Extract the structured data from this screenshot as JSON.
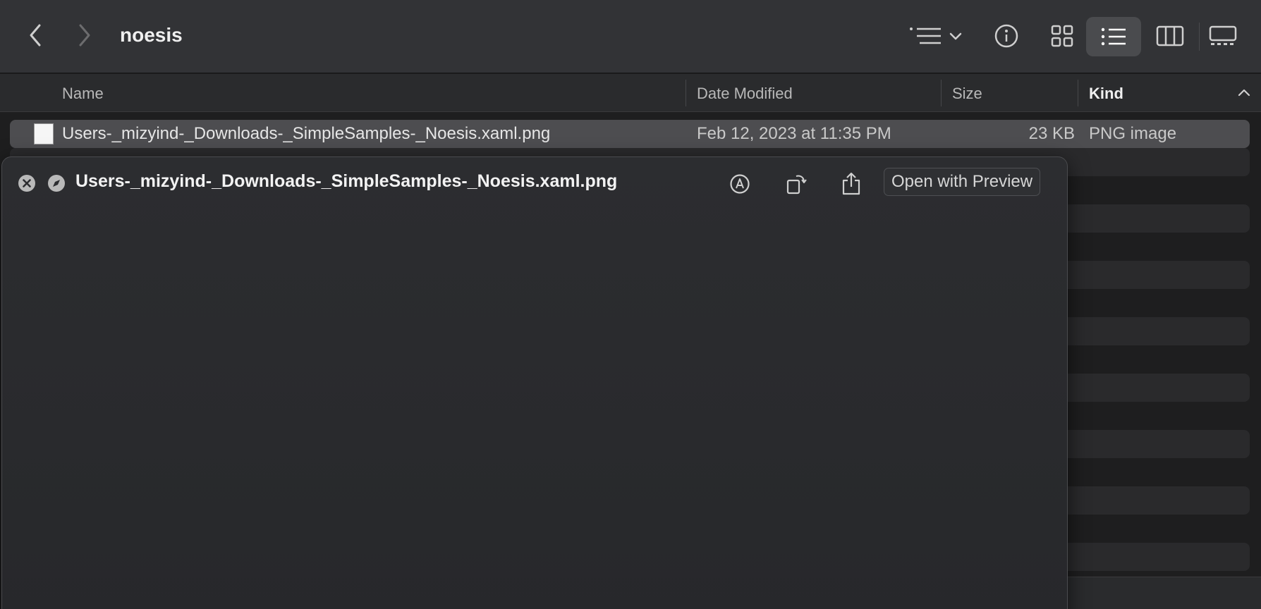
{
  "window": {
    "title": "noesis"
  },
  "toolbar": {
    "back_icon": "chevron-left-icon",
    "forward_icon": "chevron-right-icon",
    "sort_icon": "group-sort-icon",
    "info_icon": "info-icon",
    "view_icons": "icon-view-icon",
    "view_list": "list-view-icon",
    "view_columns": "column-view-icon",
    "view_gallery": "gallery-view-icon"
  },
  "columns": {
    "name": "Name",
    "date": "Date Modified",
    "size": "Size",
    "kind": "Kind"
  },
  "files": [
    {
      "name": "Users-_mizyind-_Downloads-_SimpleSamples-_Noesis.xaml.png",
      "date": "Feb 12, 2023 at 11:35 PM",
      "size": "23 KB",
      "kind": "PNG image"
    }
  ],
  "quicklook": {
    "title": "Users-_mizyind-_Downloads-_SimpleSamples-_Noesis.xaml.png",
    "open_label": "Open with Preview"
  },
  "colors": {
    "toolbar_bg": "#323336",
    "selection": "#4d4d50",
    "panel_bg": "#2c2d30"
  }
}
